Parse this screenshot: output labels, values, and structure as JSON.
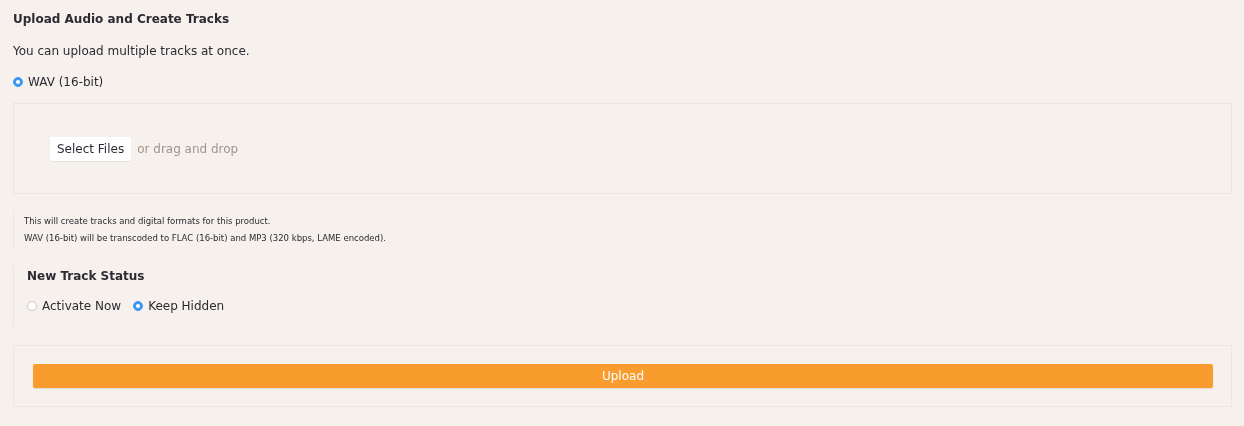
{
  "title": "Upload Audio and Create Tracks",
  "intro": "You can upload multiple tracks at once.",
  "formats": [
    {
      "label": "WAV (16-bit)",
      "selected": true
    }
  ],
  "dropzone": {
    "button": "Select Files",
    "hint": "or drag and drop"
  },
  "notes": [
    "This will create tracks and digital formats for this product.",
    "WAV (16-bit) will be transcoded to FLAC (16-bit) and MP3 (320 kbps, LAME encoded)."
  ],
  "track_status": {
    "heading": "New Track Status",
    "options": [
      {
        "label": "Activate Now",
        "selected": false
      },
      {
        "label": "Keep Hidden",
        "selected": true
      }
    ]
  },
  "upload_button": "Upload"
}
